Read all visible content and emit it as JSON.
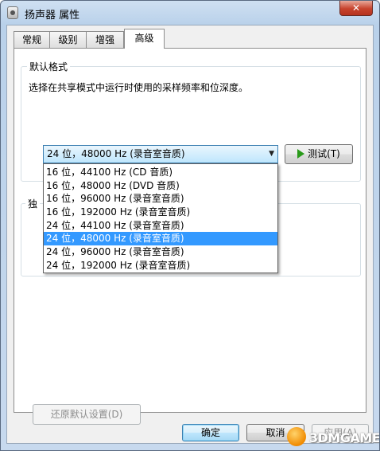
{
  "window": {
    "title": "扬声器 属性",
    "close_label": "✕"
  },
  "tabs": [
    {
      "label": "常规",
      "active": false
    },
    {
      "label": "级别",
      "active": false
    },
    {
      "label": "增强",
      "active": false
    },
    {
      "label": "高级",
      "active": true
    }
  ],
  "default_format": {
    "group_label": "默认格式",
    "description": "选择在共享模式中运行时使用的采样频率和位深度。",
    "selected_value": "24 位，48000 Hz (录音室音质)",
    "test_button_label": "测试(T)",
    "options": [
      "16 位，44100 Hz (CD 音质)",
      "16 位，48000 Hz (DVD 音质)",
      "16 位，96000 Hz (录音室音质)",
      "16 位，192000 Hz (录音室音质)",
      "24 位，44100 Hz (录音室音质)",
      "24 位，48000 Hz (录音室音质)",
      "24 位，96000 Hz (录音室音质)",
      "24 位，192000 Hz (录音室音质)"
    ],
    "highlighted_index": 5
  },
  "exclusive_group_label_fragment": "独",
  "restore_defaults_label": "还原默认设置(D)",
  "buttons": {
    "ok": "确定",
    "cancel": "取消",
    "apply": "应用(A)"
  },
  "watermark": "3DMGAME",
  "colors": {
    "highlight": "#3399ff",
    "close": "#c7432d",
    "test_icon": "#2a9a1a"
  }
}
